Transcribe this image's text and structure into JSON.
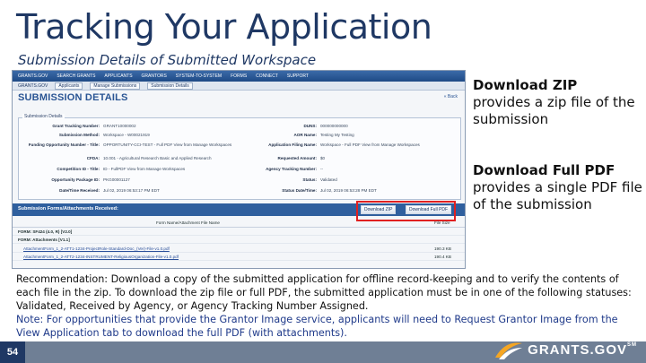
{
  "slide": {
    "title": "Tracking Your Application",
    "subtitle": "Submission Details of Submitted Workspace",
    "page_number": "54"
  },
  "screenshot": {
    "nav": [
      "GRANTS.GOV",
      "SEARCH GRANTS",
      "APPLICANTS",
      "GRANTORS",
      "SYSTEM-TO-SYSTEM",
      "FORMS",
      "CONNECT",
      "SUPPORT"
    ],
    "crumbs": [
      "GRANTS.GOV",
      "Applicants",
      "Manage Submissions",
      "Submission Details"
    ],
    "heading": "SUBMISSION DETAILS",
    "back_link": "« Back",
    "details_title": "Submission Details",
    "left_fields": [
      {
        "label": "Grant Tracking Number:",
        "value": "GRANT10000002"
      },
      {
        "label": "Submission Method:",
        "value": "Workspace - W00021919"
      },
      {
        "label": "Funding Opportunity Number - Title:",
        "value": "OPPORTUNITY-CCI-TEST - Full PDF View from Manage Workspaces"
      },
      {
        "label": "CFDA:",
        "value": "10.001 - Agricultural Research Basic and Applied Research"
      },
      {
        "label": "Competition ID - Title:",
        "value": "ID - FullPDF View from Manage Workspaces"
      },
      {
        "label": "Opportunity Package ID:",
        "value": "PKG00001127"
      },
      {
        "label": "Date/Time Received:",
        "value": "Jul 02, 2019 06:53:17 PM EDT"
      }
    ],
    "right_fields": [
      {
        "label": "DUNS:",
        "value": "000000000000"
      },
      {
        "label": "AOR Name:",
        "value": "Testing My Testing"
      },
      {
        "label": "Application Filing Name:",
        "value": "Workspace - Full PDF View from Manage Workspaces"
      },
      {
        "label": "Requested Amount:",
        "value": "$0"
      },
      {
        "label": "Agency Tracking Number:",
        "value": "--"
      },
      {
        "label": "Status:",
        "value": "Validated"
      },
      {
        "label": "Status Date/Time:",
        "value": "Jul 02, 2019 06:53:28 PM EDT"
      }
    ],
    "forms_bar_title": "Submission Forms/Attachments Received:",
    "download_zip_label": "Download ZIP",
    "download_pdf_label": "Download Full PDF",
    "col_name": "Form Name/Attachment File Name",
    "col_size": "File Size",
    "rows": [
      {
        "name": "FORM: SF424 (4.0, R) [V2.0]",
        "size": ""
      },
      {
        "name": "FORM: Attachments [V1.1]",
        "size": ""
      },
      {
        "name": "AttachmentForm_1_2-ATT1-1234-ProjectRole-Standard-Doc_(Ver)-File-v1.0.pdf",
        "size": "190.3 KB"
      },
      {
        "name": "AttachmentForm_1_2-ATT2-1234-INSTRUMENT-ReligiousOrganization-File-v1.0.pdf",
        "size": "190.4 KB"
      }
    ]
  },
  "notes": {
    "zip_heading": "Download ZIP",
    "zip_text": "provides a zip file of the submission",
    "pdf_heading": "Download Full PDF",
    "pdf_text": "provides a single PDF file of the submission"
  },
  "recommendation": {
    "text": "Recommendation: Download a copy of the submitted application for offline record-keeping and to verify the contents of each file in the zip. To download the zip file or full PDF, the submitted application must be in one of the following statuses: Validated, Received by Agency, or Agency Tracking Number Assigned.",
    "note": "Note: For opportunities that provide the Grantor Image service, applicants will need to Request Grantor Image from the View Application tab to download the full PDF (with attachments)."
  },
  "logo": {
    "text": "GRANTS.GOV",
    "mark": "SM"
  },
  "colors": {
    "title": "#1f3864",
    "highlight": "#e02020",
    "footer": "#6f7f95",
    "nav": "#2f5f9e"
  }
}
